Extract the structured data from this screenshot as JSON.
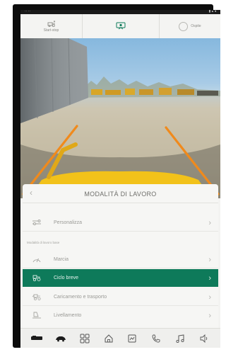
{
  "topbar": {
    "left_label": "Start-stop",
    "right_label": "Ospite"
  },
  "sheet": {
    "title": "MODALITÀ DI LAVORO",
    "subheader": "Modalità di lavoro base",
    "items": [
      {
        "label": "Personalizza",
        "icon": "sliders-icon",
        "active": false
      },
      {
        "label": "Marcia",
        "icon": "gauge-icon",
        "active": false
      },
      {
        "label": "Ciclo breve",
        "icon": "tractor-icon",
        "active": true
      },
      {
        "label": "Caricamento e trasporto",
        "icon": "loader-transport-icon",
        "active": false
      },
      {
        "label": "Livellamento",
        "icon": "leveling-icon",
        "active": false
      }
    ]
  },
  "nav": {
    "items": [
      "tractor-side-icon",
      "car-icon",
      "grid-icon",
      "home-icon",
      "machine-icon",
      "phone-icon",
      "music-icon",
      "speaker-icon"
    ]
  },
  "colors": {
    "accent": "#0e7a5a",
    "guide_lines": "#f08a1c",
    "bucket": "#f2c21a"
  }
}
